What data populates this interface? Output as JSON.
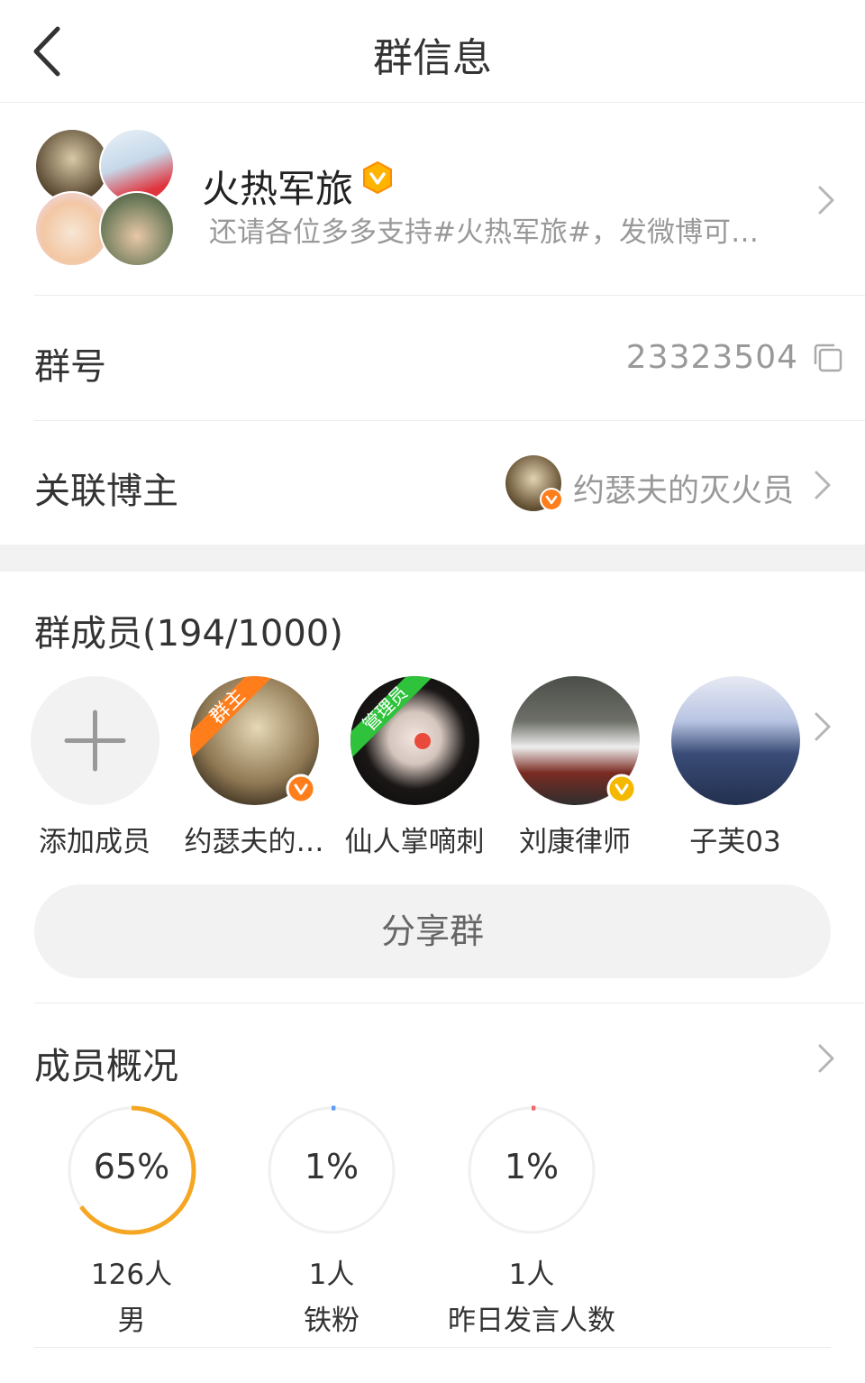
{
  "header": {
    "title": "群信息"
  },
  "group": {
    "name": "火热军旅",
    "description": "还请各位多多支持#火热军旅#，发微博可以…"
  },
  "group_number": {
    "label": "群号",
    "value": "23323504"
  },
  "linked_blogger": {
    "label": "关联博主",
    "name": "约瑟夫的灭火员"
  },
  "members": {
    "title": "群成员(194/1000)",
    "add_label": "添加成员",
    "list": [
      {
        "name": "约瑟夫的…",
        "role_tag": "群主",
        "tag_color": "#ff7e1b",
        "badge_color": "#ff7e1b"
      },
      {
        "name": "仙人掌嘀刺",
        "role_tag": "管理员",
        "tag_color": "#2ec33b"
      },
      {
        "name": "刘康律师",
        "badge_color": "#f5b800"
      },
      {
        "name": "子芙03"
      }
    ]
  },
  "share_button": "分享群",
  "overview": {
    "title": "成员概况",
    "stats": [
      {
        "percent_text": "65%",
        "percent": 65,
        "count": "126人",
        "label": "男",
        "color": "#f5a623"
      },
      {
        "percent_text": "1%",
        "percent": 1,
        "count": "1人",
        "label": "铁粉",
        "color": "#5b9bf0"
      },
      {
        "percent_text": "1%",
        "percent": 1,
        "count": "1人",
        "label": "昨日发言人数",
        "color": "#f06767"
      }
    ]
  },
  "colors": {
    "accent": "#ff8200",
    "divider": "#ececec",
    "gray_text": "#999999"
  }
}
